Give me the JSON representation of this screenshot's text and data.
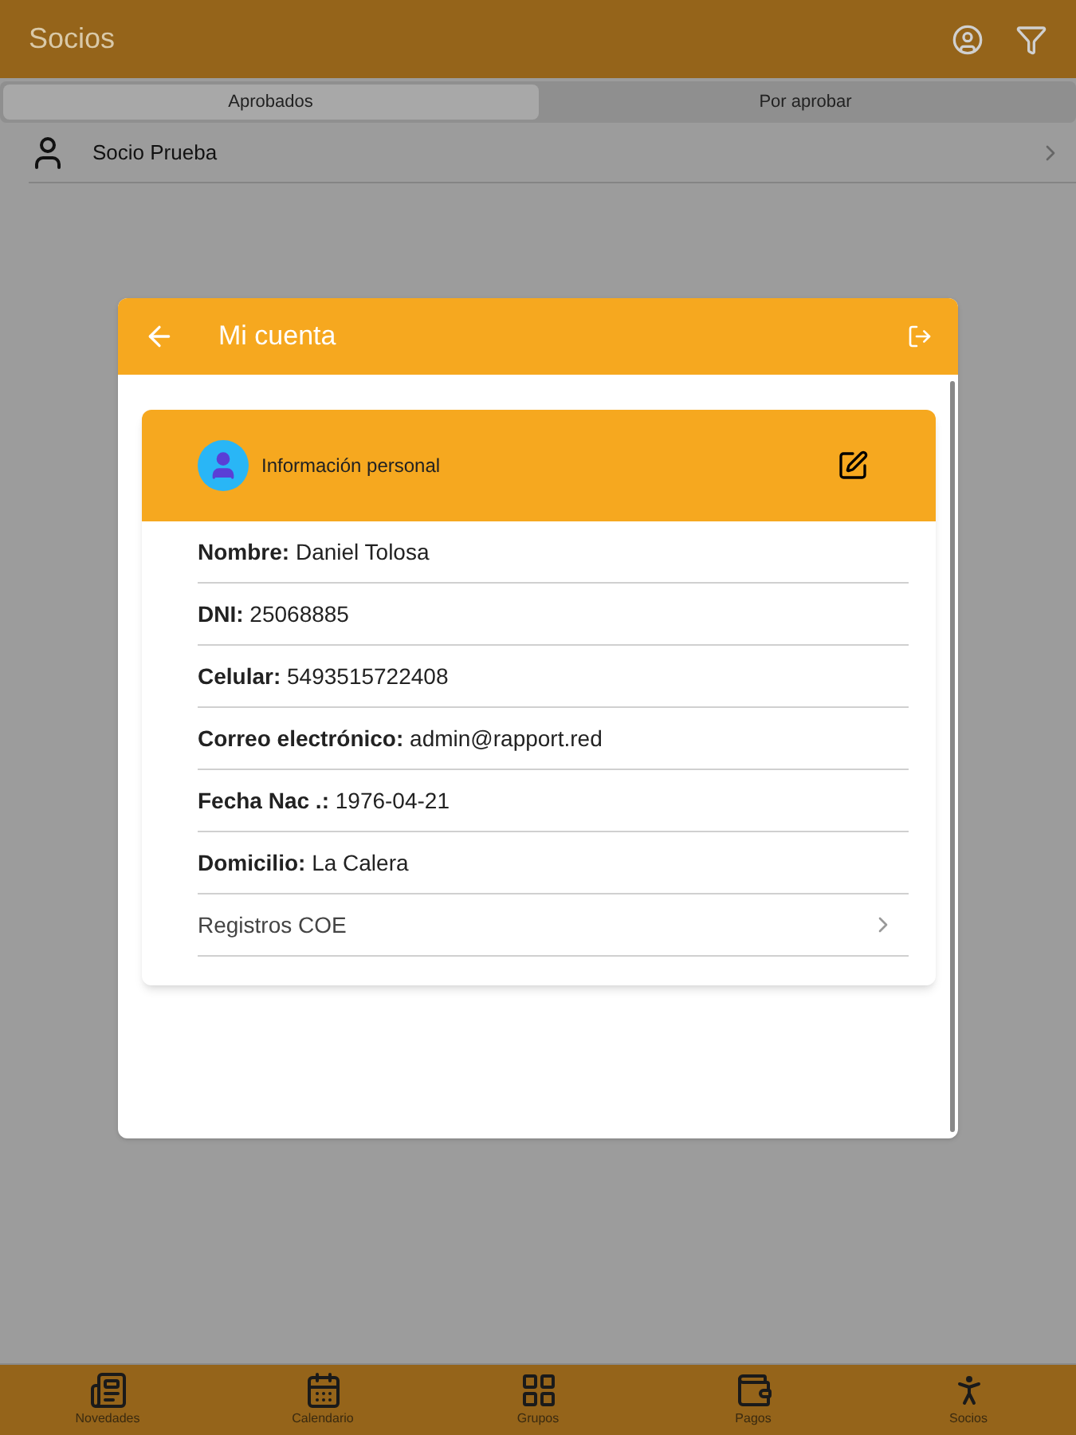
{
  "app_bar": {
    "title": "Socios"
  },
  "tabs": [
    {
      "label": "Aprobados",
      "selected": true
    },
    {
      "label": "Por aprobar",
      "selected": false
    }
  ],
  "members": [
    {
      "name": "Socio Prueba"
    }
  ],
  "dialog": {
    "title": "Mi cuenta",
    "card": {
      "title": "Información personal",
      "rows": [
        {
          "kind": "field",
          "label": "Nombre:",
          "value": "Daniel Tolosa"
        },
        {
          "kind": "field",
          "label": "DNI:",
          "value": "25068885"
        },
        {
          "kind": "field",
          "label": "Celular:",
          "value": "5493515722408"
        },
        {
          "kind": "field",
          "label": "Correo electrónico:",
          "value": "admin@rapport.red"
        },
        {
          "kind": "field",
          "label": "Fecha Nac .:",
          "value": "1976-04-21"
        },
        {
          "kind": "field",
          "label": "Domicilio:",
          "value": "La Calera"
        },
        {
          "kind": "link",
          "label": "Registros COE"
        }
      ]
    }
  },
  "bottom_nav": [
    {
      "label": "Novedades"
    },
    {
      "label": "Calendario"
    },
    {
      "label": "Grupos"
    },
    {
      "label": "Pagos"
    },
    {
      "label": "Socios"
    }
  ]
}
